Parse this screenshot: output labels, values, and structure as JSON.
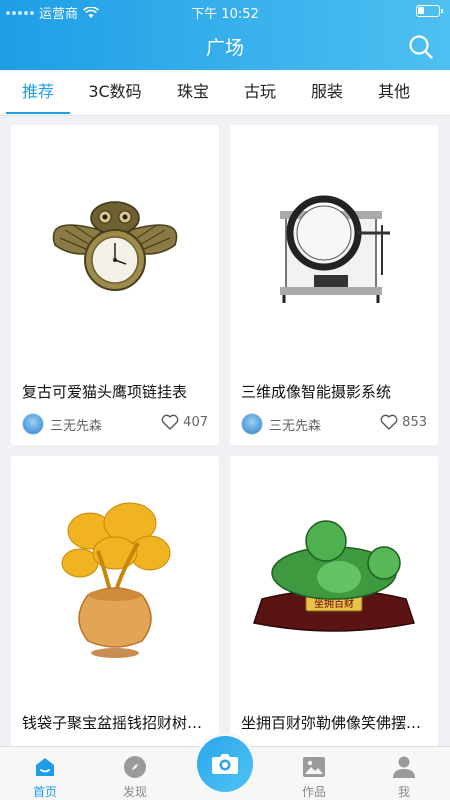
{
  "status_bar": {
    "carrier": "运营商",
    "time": "下午 10:52"
  },
  "header": {
    "title": "广场",
    "search_icon": "search-icon"
  },
  "tabs": [
    {
      "label": "推荐",
      "active": true
    },
    {
      "label": "3C数码",
      "active": false
    },
    {
      "label": "珠宝",
      "active": false
    },
    {
      "label": "古玩",
      "active": false
    },
    {
      "label": "服装",
      "active": false
    },
    {
      "label": "其他",
      "active": false
    }
  ],
  "cards": [
    {
      "title": "复古可爱猫头鹰项链挂表",
      "author": "三无先森",
      "likes": "407",
      "image": "owl-pocket-watch-image"
    },
    {
      "title": "三维成像智能摄影系统",
      "author": "三无先森",
      "likes": "853",
      "image": "photo-studio-box-image"
    },
    {
      "title": "钱袋子聚宝盆摇钱招财树…",
      "author": "",
      "likes": "",
      "image": "money-tree-ornament-image"
    },
    {
      "title": "坐拥百财弥勒佛像笑佛摆…",
      "author": "",
      "likes": "",
      "image": "jade-buddha-statue-image"
    }
  ],
  "statue_plaque": "坐拥百财",
  "bottom_nav": [
    {
      "label": "首页",
      "icon": "home-icon",
      "active": true
    },
    {
      "label": "发现",
      "icon": "compass-icon",
      "active": false
    },
    {
      "label": "",
      "icon": "camera-icon",
      "active": false
    },
    {
      "label": "作品",
      "icon": "picture-icon",
      "active": false
    },
    {
      "label": "我",
      "icon": "person-icon",
      "active": false
    }
  ],
  "colors": {
    "accent": "#1e9ee6",
    "header_gradient_end": "#4ec0f1",
    "background": "#f0f1f4"
  }
}
